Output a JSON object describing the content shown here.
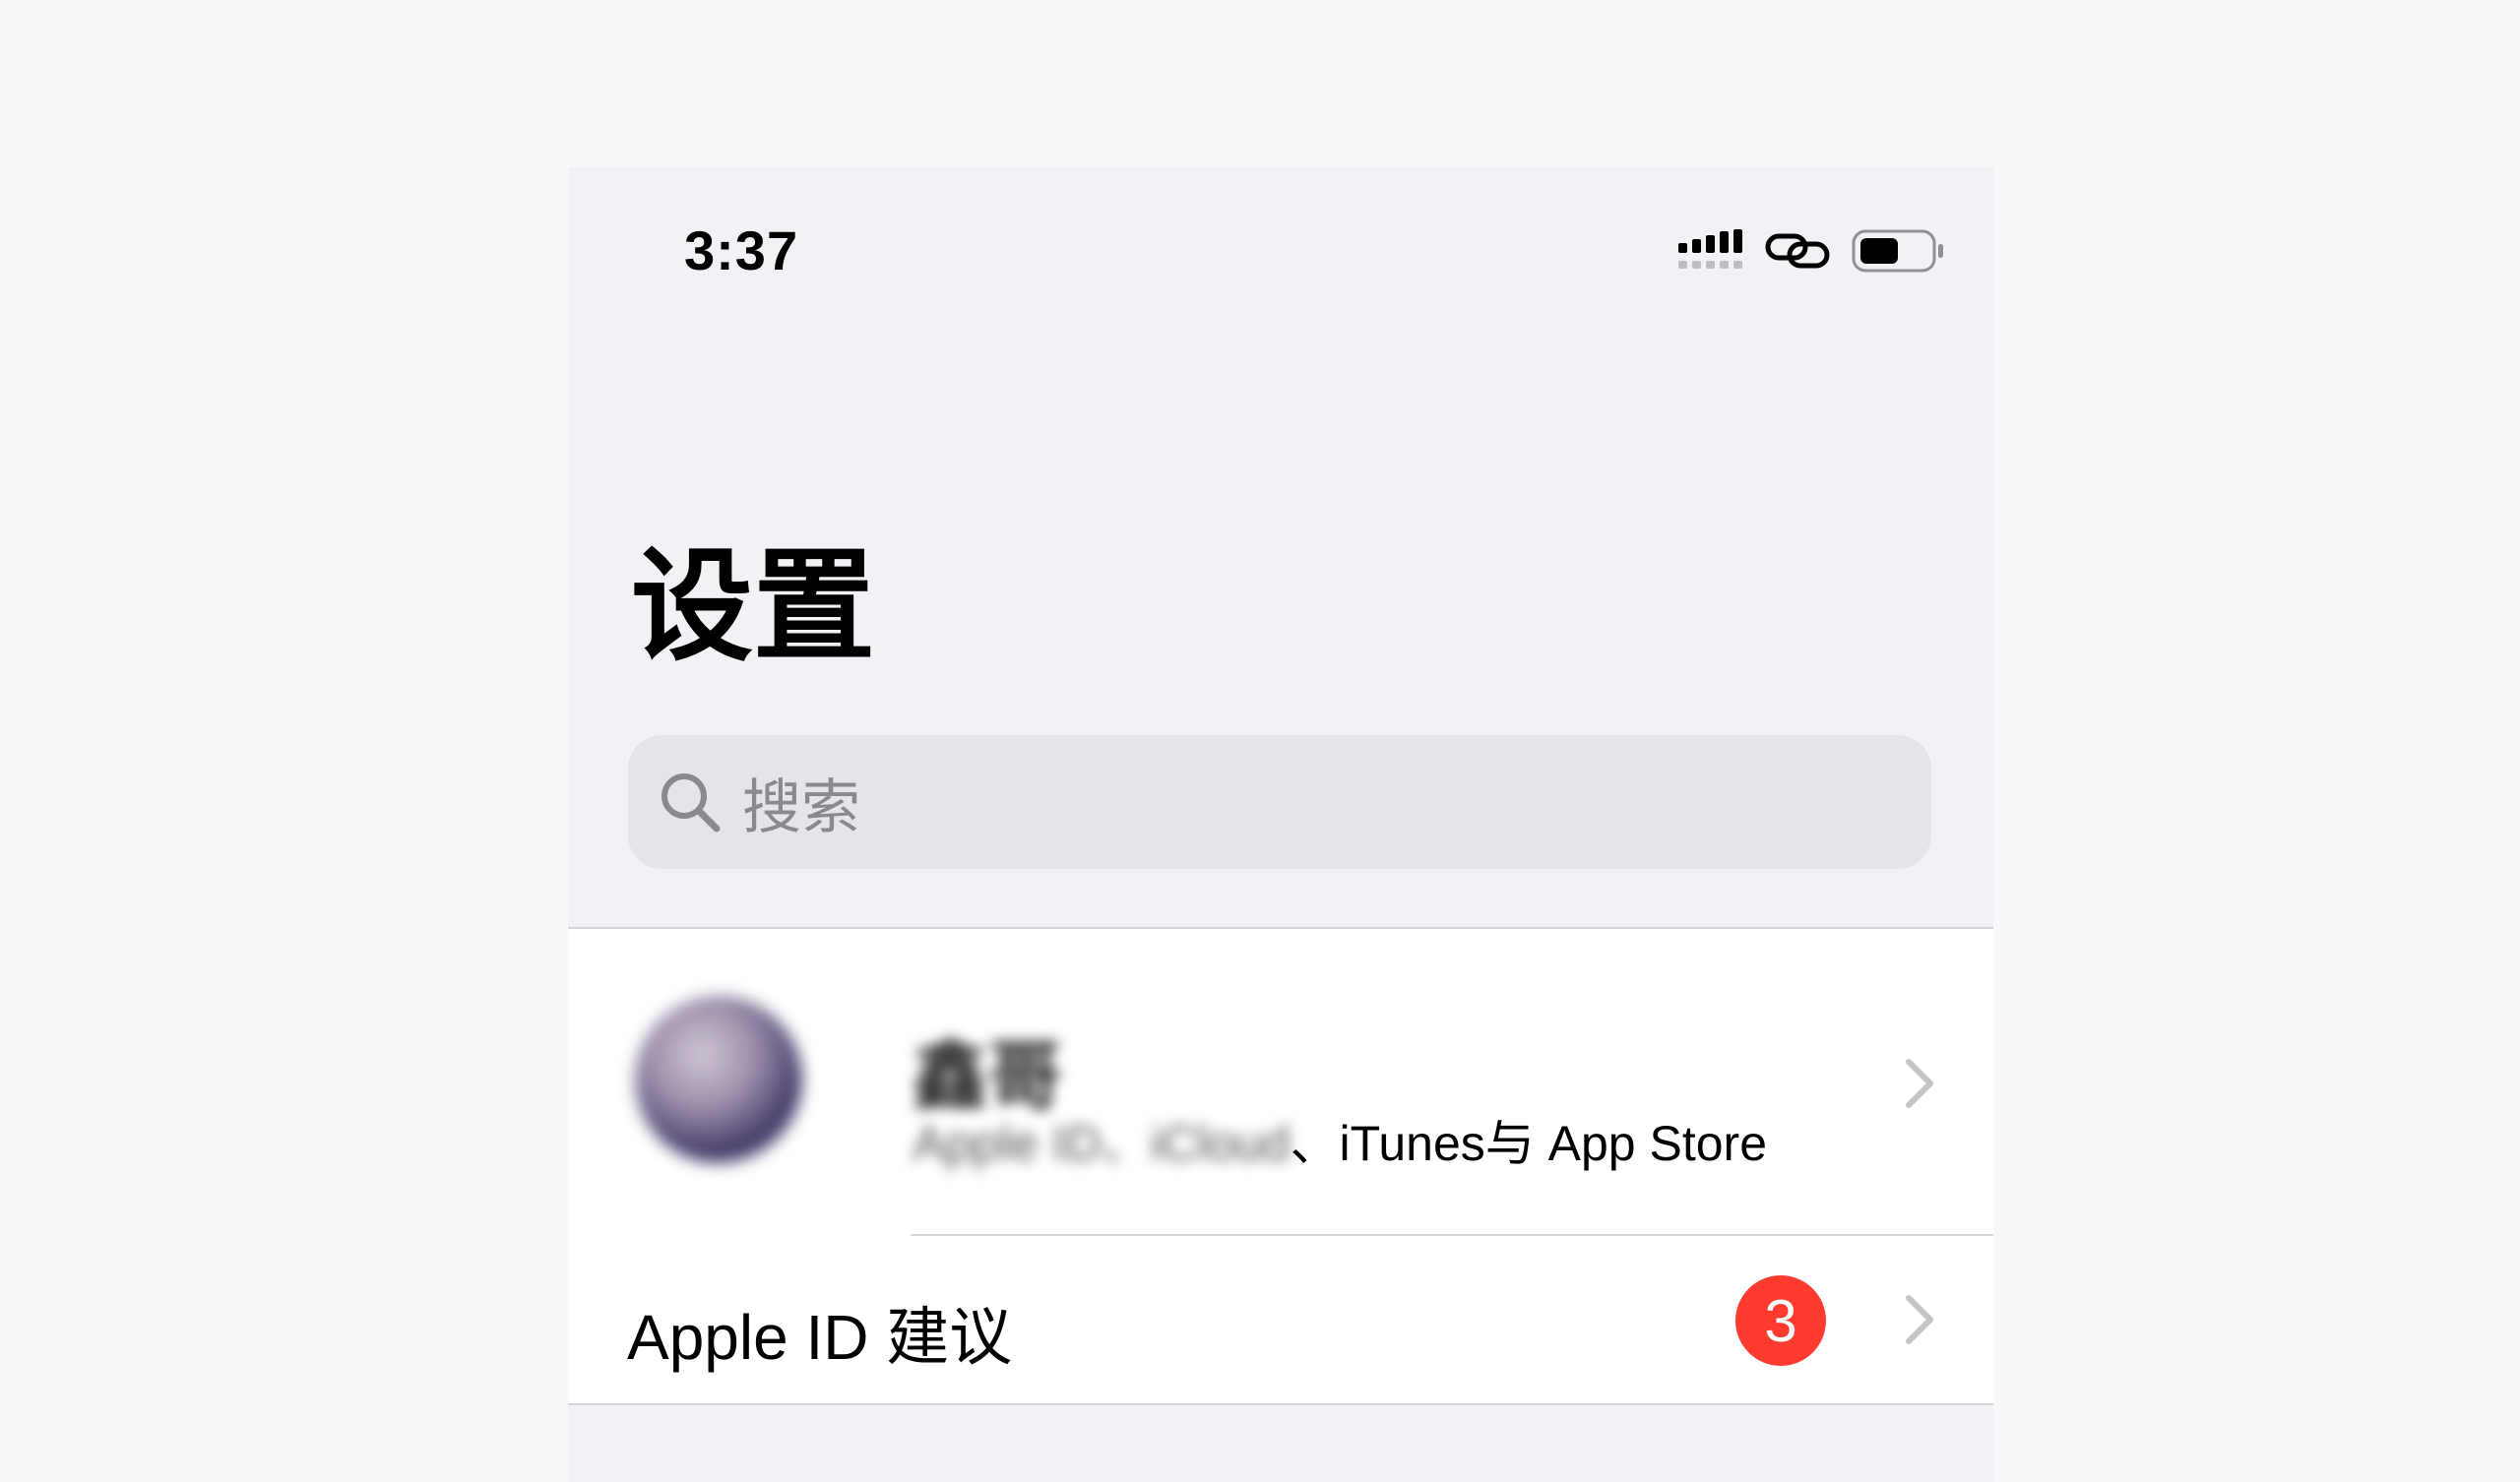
{
  "status_bar": {
    "time": "3:37",
    "icons": [
      "cellular-signal-icon",
      "personal-hotspot-link-icon",
      "battery-icon"
    ],
    "battery_level": 0.5
  },
  "nav": {
    "title": "设置"
  },
  "search": {
    "icon": "search-icon",
    "placeholder": "搜索"
  },
  "profile": {
    "name": "鑫哥",
    "subtitle_blurred": "Apple ID、iCloud",
    "subtitle_separator": "、",
    "subtitle_visible": "iTunes与 App Store",
    "chevron": "chevron-right-icon"
  },
  "apple_id_suggestions": {
    "label": "Apple ID 建议",
    "badge_count": "3",
    "chevron": "chevron-right-icon"
  },
  "colors": {
    "background": "#f2f2f6",
    "badge": "#ff3b30",
    "chevron": "#c4c4c7",
    "search_field": "#e4e4e9"
  }
}
